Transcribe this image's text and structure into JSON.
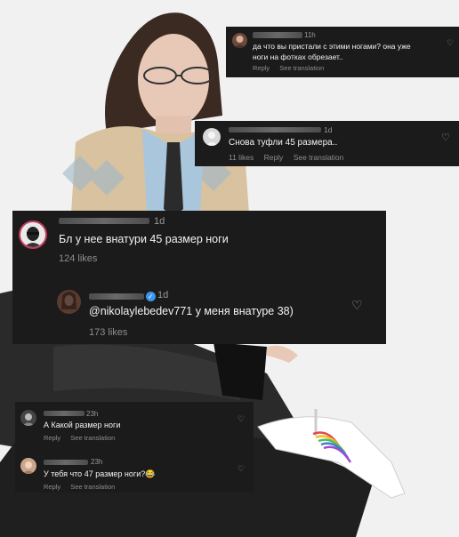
{
  "comments": [
    {
      "time": "11h",
      "text_line1": "да что вы пристали с этими ногами? она уже",
      "text_line2": "ноги на фотках обрезает..",
      "reply": "Reply",
      "see_translation": "See translation"
    },
    {
      "time": "1d",
      "text": "Снова туфли 45 размера..",
      "likes": "11 likes",
      "reply": "Reply",
      "see_translation": "See translation"
    },
    {
      "time": "1d",
      "text": "Бл у нее внатури 45 размер ноги",
      "likes": "124 likes"
    },
    {
      "time": "1d",
      "text": "@nikolaylebedev771 у меня внатуре 38)",
      "likes": "173 likes"
    },
    {
      "time": "23h",
      "text": "А Какой размер ноги",
      "reply": "Reply",
      "see_translation": "See translation"
    },
    {
      "time": "23h",
      "text": "У тебя что 47 размер ноги?😂",
      "reply": "Reply",
      "see_translation": "See translation"
    }
  ],
  "colors": {
    "card_bg": "#1b1b1b",
    "muted_text": "#8e8e8e",
    "verified_blue": "#3897f0"
  }
}
